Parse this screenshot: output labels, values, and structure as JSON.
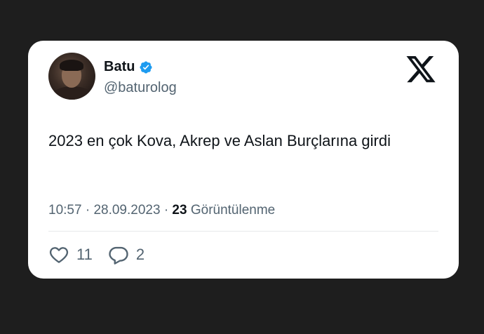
{
  "author": {
    "display_name": "Batu",
    "handle": "@baturolog",
    "avatar_icon": "user-avatar",
    "verified_icon": "verified-badge-icon",
    "verified_color": "#1d9bf0"
  },
  "brand": {
    "logo_icon": "x-logo-icon",
    "logo_color": "#0f1419"
  },
  "tweet": {
    "text": "2023 en çok Kova, Akrep ve Aslan Burçlarına girdi",
    "time": "10:57",
    "separator": "·",
    "date": "28.09.2023",
    "views_count": "23",
    "views_label": "Görüntülenme"
  },
  "actions": {
    "like_icon": "heart-icon",
    "like_count": "11",
    "reply_icon": "reply-bubble-icon",
    "reply_count": "2"
  },
  "colors": {
    "background": "#1e1e1e",
    "card": "#ffffff",
    "text_primary": "#0f1419",
    "text_secondary": "#536471"
  }
}
